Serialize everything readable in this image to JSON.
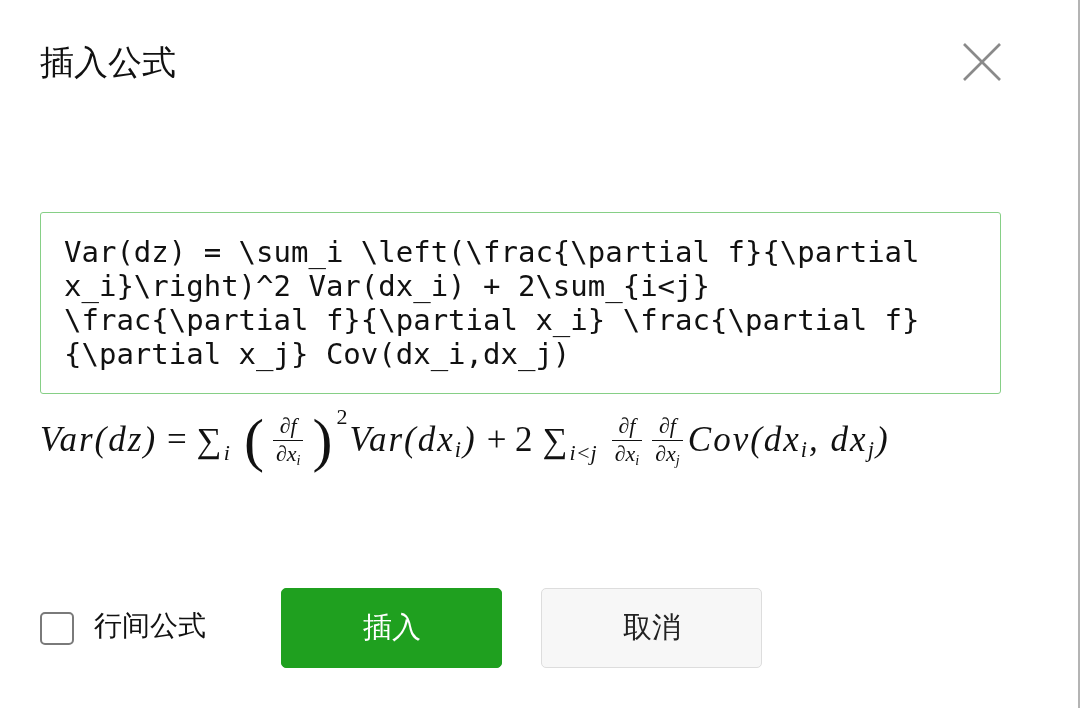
{
  "dialog": {
    "title": "插入公式"
  },
  "formula_input": {
    "value": "Var(dz) = \\sum_i \\left(\\frac{\\partial f}{\\partial x_i}\\right)^2 Var(dx_i) + 2\\sum_{i<j} \\frac{\\partial f}{\\partial x_i} \\frac{\\partial f}{\\partial x_j} Cov(dx_i,dx_j)",
    "focused": true
  },
  "preview": {
    "parts": [
      {
        "kind": "var",
        "text": "Var(dz)"
      },
      {
        "kind": "op",
        "text": "="
      },
      {
        "kind": "sum",
        "symbol": "∑",
        "sub": "i"
      },
      {
        "kind": "group",
        "open": "(",
        "close": ")",
        "sup": "2",
        "parts": [
          {
            "kind": "frac",
            "num": "∂f",
            "den": "∂x$_{i}$"
          }
        ]
      },
      {
        "kind": "var",
        "text": "Var(dx$_{i}$)"
      },
      {
        "kind": "op",
        "text": "+ 2"
      },
      {
        "kind": "sum",
        "symbol": "∑",
        "sub": "i<j"
      },
      {
        "kind": "frac",
        "num": "∂f",
        "den": "∂x$_{i}$"
      },
      {
        "kind": "frac",
        "num": "∂f",
        "den": "∂x$_{j}$"
      },
      {
        "kind": "var",
        "text": "Cov(dx$_{i}$, dx$_{j}$)"
      }
    ]
  },
  "display_mode": {
    "label": "行间公式",
    "checked": false
  },
  "buttons": [
    {
      "label": "插入",
      "kind": "primary"
    },
    {
      "label": "取消",
      "kind": "secondary"
    }
  ]
}
